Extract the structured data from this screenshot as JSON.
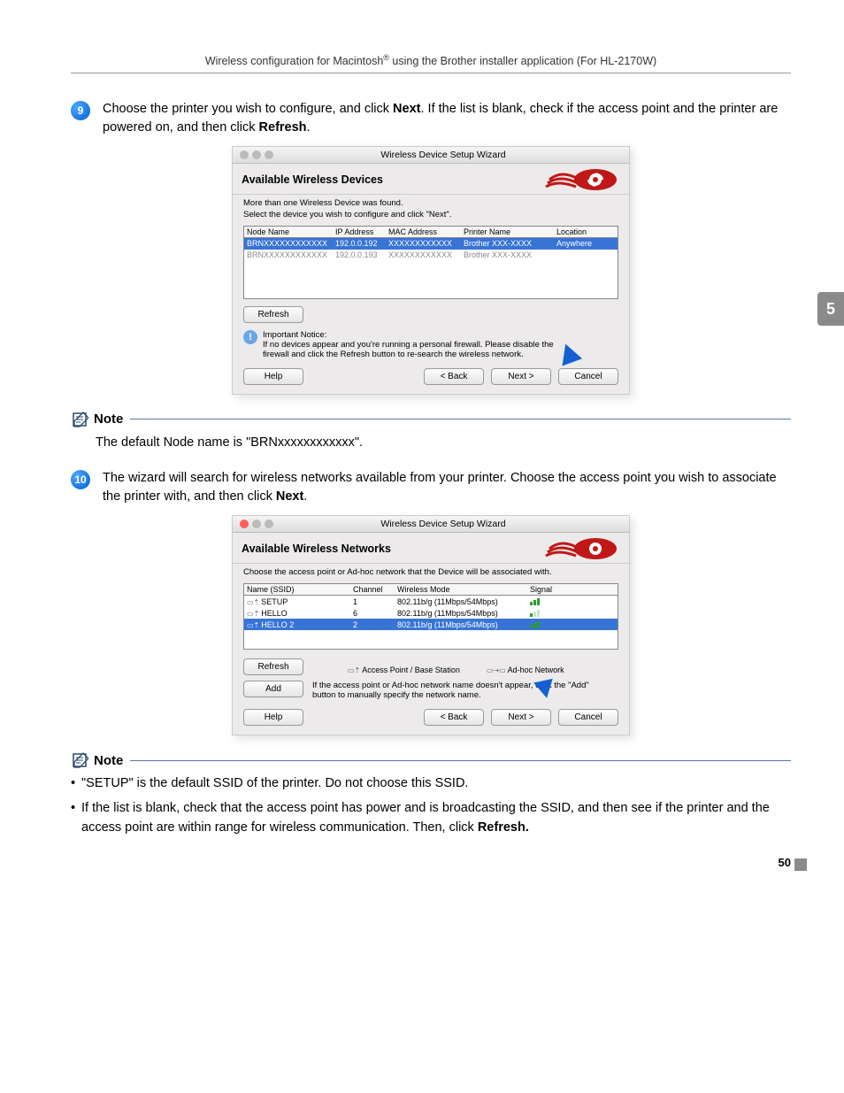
{
  "header": {
    "text_before_sup": "Wireless configuration for Macintosh",
    "sup": "®",
    "text_after_sup": " using the Brother installer application (For HL-2170W)"
  },
  "step9": {
    "num": "9",
    "text_a": "Choose the printer you wish to configure, and click ",
    "next": "Next",
    "text_b": ". If the list is blank, check if the access point and the printer are powered on, and then click ",
    "refresh": "Refresh",
    "text_c": "."
  },
  "dialog1": {
    "window_title": "Wireless Device Setup Wizard",
    "title": "Available Wireless Devices",
    "intro1": "More than one Wireless Device was found.",
    "intro2": "Select the device you wish to configure and click \"Next\".",
    "cols": [
      "Node Name",
      "IP Address",
      "MAC Address",
      "Printer Name",
      "Location"
    ],
    "rows": [
      {
        "cells": [
          "BRNXXXXXXXXXXXX",
          "192.0.0.192",
          "XXXXXXXXXXXX",
          "Brother XXX-XXXX",
          "Anywhere"
        ],
        "sel": true
      },
      {
        "cells": [
          "BRNXXXXXXXXXXXX",
          "192.0.0.193",
          "XXXXXXXXXXXX",
          "Brother XXX-XXXX",
          " "
        ],
        "sel": false
      }
    ],
    "refresh": "Refresh",
    "notice_label": "Important Notice:",
    "notice_text": "If no devices appear and you're running a personal firewall. Please disable the firewall and click the Refresh button to re-search the wireless network.",
    "help": "Help",
    "back": "< Back",
    "next": "Next >",
    "cancel": "Cancel"
  },
  "note1": {
    "label": "Note",
    "text": "The default Node name is \"BRNxxxxxxxxxxxx\"."
  },
  "step10": {
    "num": "10",
    "text_a": "The wizard will search for wireless networks available from your printer. Choose the access point you wish to associate the printer with, and then click ",
    "next": "Next",
    "text_b": "."
  },
  "dialog2": {
    "window_title": "Wireless Device Setup Wizard",
    "title": "Available Wireless Networks",
    "intro": "Choose the access point or Ad-hoc network that the Device will be associated with.",
    "cols": [
      "Name (SSID)",
      "Channel",
      "Wireless Mode",
      "Signal"
    ],
    "rows": [
      {
        "name": "SETUP",
        "ch": "1",
        "mode": "802.11b/g (11Mbps/54Mbps)",
        "sig": "mid",
        "ico": "ap"
      },
      {
        "name": "HELLO",
        "ch": "6",
        "mode": "802.11b/g (11Mbps/54Mbps)",
        "sig": "low",
        "ico": "ap"
      },
      {
        "name": "HELLO 2",
        "ch": "2",
        "mode": "802.11b/g (11Mbps/54Mbps)",
        "sig": "mid",
        "ico": "ap",
        "sel": true
      }
    ],
    "refresh": "Refresh",
    "legend_ap": "Access Point / Base Station",
    "legend_adhoc": "Ad-hoc Network",
    "add": "Add",
    "add_note": "If the access point or Ad-hoc network name doesn't appear, click the \"Add\" button to manually specify the network name.",
    "help": "Help",
    "back": "< Back",
    "next": "Next >",
    "cancel": "Cancel"
  },
  "note2": {
    "label": "Note",
    "bullet1": "\"SETUP\" is the default SSID of the printer. Do not choose this SSID.",
    "bullet2_a": "If the list is blank, check that the access point has power and is broadcasting the SSID, and then see if the printer and the access point are within range for wireless communication. Then, click ",
    "bullet2_b": "Refresh."
  },
  "side_tab": "5",
  "page_number": "50"
}
